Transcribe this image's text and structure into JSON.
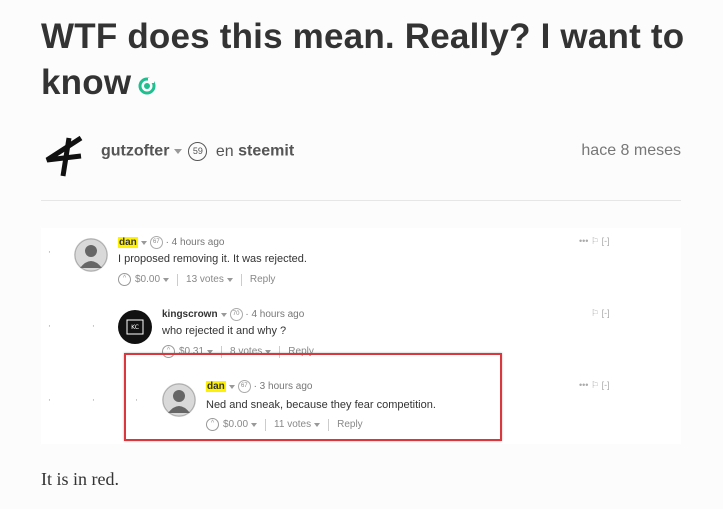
{
  "post": {
    "title": "WTF does this mean. Really? I want to know",
    "author": "gutzofter",
    "reputation": "59",
    "in_label": "en",
    "community": "steemit",
    "time_ago": "hace 8 meses"
  },
  "comments": [
    {
      "author": "dan",
      "reputation": "67",
      "time": "· 4 hours ago",
      "body": "I proposed removing it. It was rejected.",
      "payout": "$0.00",
      "votes": "13 votes",
      "reply": "Reply",
      "controls": "[-]"
    },
    {
      "author": "kingscrown",
      "reputation": "70",
      "time": "· 4 hours ago",
      "body": "who rejected it and why ?",
      "payout": "$0.31",
      "votes": "8 votes",
      "reply": "Reply",
      "controls": "[-]"
    },
    {
      "author": "dan",
      "reputation": "67",
      "time": "· 3 hours ago",
      "body": "Ned and sneak, because they fear competition.",
      "payout": "$0.00",
      "votes": "11 votes",
      "reply": "Reply",
      "controls": "[-]"
    }
  ],
  "footer_text": "It is in red.",
  "colors": {
    "highlight_box": "#d9363e",
    "name_highlight": "#fff200",
    "steem_icon": "#1fbf8f"
  }
}
